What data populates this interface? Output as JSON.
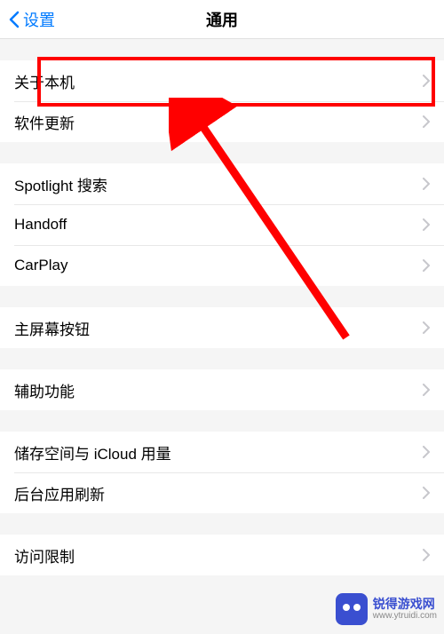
{
  "nav": {
    "back_label": "设置",
    "title": "通用"
  },
  "groups": [
    {
      "items": [
        {
          "label": "关于本机",
          "name": "about-item"
        },
        {
          "label": "软件更新",
          "name": "software-update-item"
        }
      ]
    },
    {
      "items": [
        {
          "label": "Spotlight 搜索",
          "name": "spotlight-item"
        },
        {
          "label": "Handoff",
          "name": "handoff-item"
        },
        {
          "label": "CarPlay",
          "name": "carplay-item"
        }
      ]
    },
    {
      "items": [
        {
          "label": "主屏幕按钮",
          "name": "home-button-item"
        }
      ]
    },
    {
      "items": [
        {
          "label": "辅助功能",
          "name": "accessibility-item"
        }
      ]
    },
    {
      "items": [
        {
          "label": "储存空间与 iCloud 用量",
          "name": "storage-icloud-item"
        },
        {
          "label": "后台应用刷新",
          "name": "background-refresh-item"
        }
      ]
    },
    {
      "items": [
        {
          "label": "访问限制",
          "name": "restrictions-item"
        }
      ]
    }
  ],
  "watermark": {
    "title": "锐得游戏网",
    "url": "www.ytruidi.com"
  }
}
